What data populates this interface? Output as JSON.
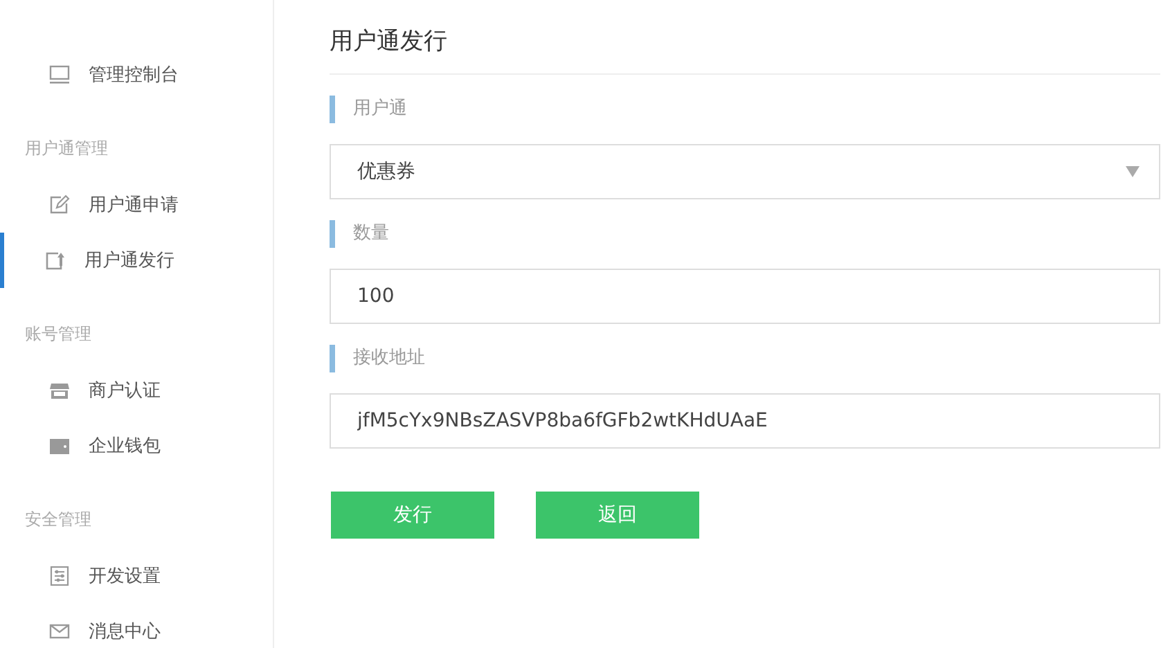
{
  "sidebar": {
    "groups": [
      {
        "items": [
          {
            "label": "管理控制台",
            "kind": "monitor",
            "selected": false
          }
        ]
      },
      {
        "title": "用户通管理",
        "items": [
          {
            "label": "用户通申请",
            "kind": "edit",
            "selected": false
          },
          {
            "label": "用户通发行",
            "kind": "issue",
            "selected": true
          }
        ]
      },
      {
        "title": "账号管理",
        "items": [
          {
            "label": "商户认证",
            "kind": "store",
            "selected": false
          },
          {
            "label": "企业钱包",
            "kind": "wallet",
            "selected": false
          }
        ]
      },
      {
        "title": "安全管理",
        "items": [
          {
            "label": "开发设置",
            "kind": "settings",
            "selected": false
          },
          {
            "label": "消息中心",
            "kind": "mail",
            "selected": false
          }
        ]
      }
    ]
  },
  "page": {
    "title": "用户通发行",
    "fields": [
      {
        "label": "用户通",
        "kind": "select",
        "value": "优惠券"
      },
      {
        "label": "数量",
        "kind": "input",
        "value": "100"
      },
      {
        "label": "接收地址",
        "kind": "input",
        "value": "jfM5cYx9NBsZASVP8ba6fGFb2wtKHdUAaE"
      }
    ],
    "buttons": [
      "发行",
      "返回"
    ]
  }
}
